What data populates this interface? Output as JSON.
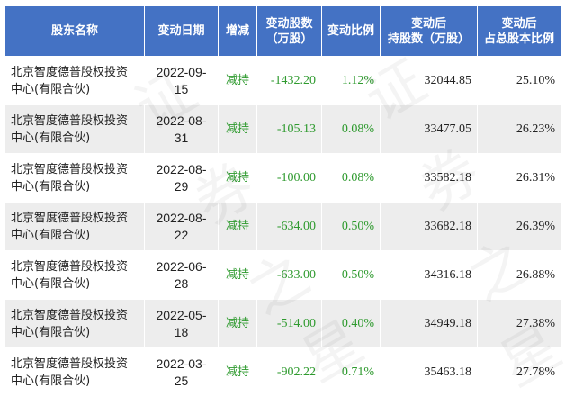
{
  "table": {
    "headers": [
      [
        "股东名称"
      ],
      [
        "变动日期"
      ],
      [
        "增减"
      ],
      [
        "变动股数",
        "（万股）"
      ],
      [
        "变动比例"
      ],
      [
        "变动后",
        "持股数（万股）"
      ],
      [
        "变动后",
        "占总股本比例"
      ]
    ],
    "rows": [
      {
        "holder": [
          "北京智度德普股权投资",
          "中心(有限合伙)"
        ],
        "date": "2022-09-15",
        "direction": "减持",
        "change": "-1432.20",
        "ratio": "1.12%",
        "after_shares": "32044.85",
        "after_pct": "25.10%"
      },
      {
        "holder": [
          "北京智度德普股权投资",
          "中心(有限合伙)"
        ],
        "date": "2022-08-31",
        "direction": "减持",
        "change": "-105.13",
        "ratio": "0.08%",
        "after_shares": "33477.05",
        "after_pct": "26.23%"
      },
      {
        "holder": [
          "北京智度德普股权投资",
          "中心(有限合伙)"
        ],
        "date": "2022-08-29",
        "direction": "减持",
        "change": "-100.00",
        "ratio": "0.08%",
        "after_shares": "33582.18",
        "after_pct": "26.31%"
      },
      {
        "holder": [
          "北京智度德普股权投资",
          "中心(有限合伙)"
        ],
        "date": "2022-08-22",
        "direction": "减持",
        "change": "-634.00",
        "ratio": "0.50%",
        "after_shares": "33682.18",
        "after_pct": "26.39%"
      },
      {
        "holder": [
          "北京智度德普股权投资",
          "中心(有限合伙)"
        ],
        "date": "2022-06-28",
        "direction": "减持",
        "change": "-633.00",
        "ratio": "0.50%",
        "after_shares": "34316.18",
        "after_pct": "26.88%"
      },
      {
        "holder": [
          "北京智度德普股权投资",
          "中心(有限合伙)"
        ],
        "date": "2022-05-18",
        "direction": "减持",
        "change": "-514.00",
        "ratio": "0.40%",
        "after_shares": "34949.18",
        "after_pct": "27.38%"
      },
      {
        "holder": [
          "北京智度德普股权投资",
          "中心(有限合伙)"
        ],
        "date": "2022-03-25",
        "direction": "减持",
        "change": "-902.22",
        "ratio": "0.71%",
        "after_shares": "35463.18",
        "after_pct": "27.78%"
      }
    ]
  },
  "watermark": {
    "chars": [
      "证",
      "券",
      "之",
      "星",
      "证",
      "券",
      "之",
      "星"
    ]
  },
  "colors": {
    "header_bg": "#4472c4",
    "header_text": "#ffffff",
    "row_alt": "#ededed",
    "decrease_green": "#2e9a2e"
  }
}
